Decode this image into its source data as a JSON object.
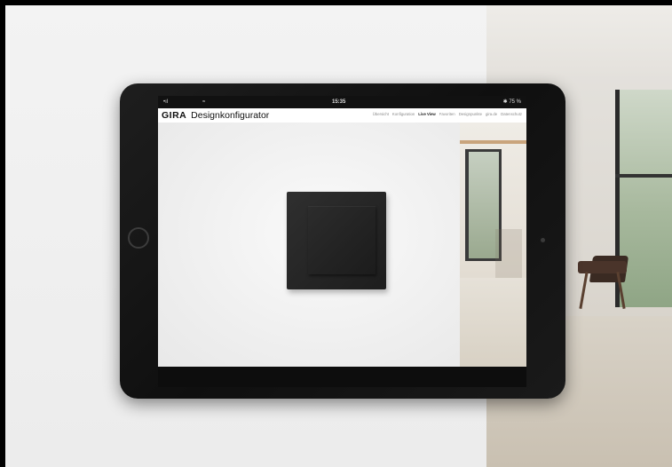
{
  "status_bar": {
    "time": "15:35",
    "signal": "•ıl",
    "wifi": "≈",
    "battery": "✱ 75 %"
  },
  "header": {
    "brand": "GIRA",
    "product": "Designkonfigurator"
  },
  "nav": {
    "items": [
      {
        "label": "Übersicht",
        "active": false
      },
      {
        "label": "Konfiguration",
        "active": false
      },
      {
        "label": "Live View",
        "active": true
      },
      {
        "label": "Favoriten",
        "active": false
      },
      {
        "label": "Designpunkte",
        "active": false
      },
      {
        "label": "gira.de",
        "active": false
      },
      {
        "label": "Datenschutz",
        "active": false
      }
    ]
  },
  "product": {
    "name": "switch",
    "color": "#262626"
  },
  "colors": {
    "tablet_bezel": "#141414",
    "screen_bg": "#ffffff",
    "page_bg": "#f0f0f0"
  }
}
